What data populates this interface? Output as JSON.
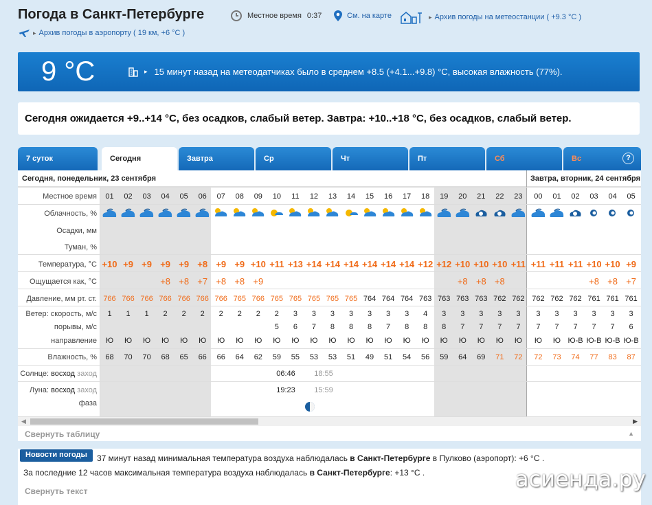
{
  "header": {
    "title": "Погода в Санкт-Петербурге",
    "local_time_label": "Местное время",
    "local_time_value": "0:37",
    "map_link": "См. на карте",
    "station_archive": "Архив погоды на метеостанции ( +9.3 °C )",
    "airport_archive": "Архив погоды в аэропорту ( 19 км, +6 °C )"
  },
  "current": {
    "temp": "9 °C",
    "desc": "15 минут назад на метеодатчиках было в среднем +8.5 (+4.1...+9.8) °C, высокая влажность (77%)."
  },
  "forecast_summary": "Сегодня ожидается +9..+14 °C, без осадков, слабый ветер. Завтра: +10..+18 °C, без осадков, слабый ветер.",
  "tabs": [
    "7 суток",
    "Сегодня",
    "Завтра",
    "Ср",
    "Чт",
    "Пт",
    "Сб",
    "Вс"
  ],
  "help_label": "?",
  "table": {
    "today_header": "Сегодня, понедельник, 23 сентября",
    "tomorrow_header": "Завтра, вторник, 24 сентября",
    "labels": {
      "time": "Местное время",
      "clouds": "Облачность, %",
      "precip": "Осадки, мм",
      "fog": "Туман, %",
      "temp": "Температура, °C",
      "feels": "Ощущается как, °C",
      "pressure": "Давление, мм рт. ст.",
      "wind_speed": "Ветер: скорость, м/с",
      "gusts": "порывы, м/с",
      "direction": "направление",
      "humidity": "Влажность, %",
      "sun_prefix": "Солнце:",
      "sun_rise": "восход",
      "sun_set": "заход",
      "moon_prefix": "Луна:",
      "moon_rise": "восход",
      "moon_set": "заход",
      "phase": "фаза"
    },
    "hours": [
      "01",
      "02",
      "03",
      "04",
      "05",
      "06",
      "07",
      "08",
      "09",
      "10",
      "11",
      "12",
      "13",
      "14",
      "15",
      "16",
      "17",
      "18",
      "19",
      "20",
      "21",
      "22",
      "23",
      "00",
      "01",
      "02",
      "03",
      "04",
      "05"
    ],
    "temp": [
      "+10",
      "+9",
      "+9",
      "+9",
      "+9",
      "+8",
      "+9",
      "+9",
      "+10",
      "+11",
      "+13",
      "+14",
      "+14",
      "+14",
      "+14",
      "+14",
      "+14",
      "+12",
      "+12",
      "+10",
      "+10",
      "+10",
      "+11",
      "+11",
      "+11",
      "+11",
      "+10",
      "+10",
      "+9"
    ],
    "feels": [
      "",
      "",
      "",
      "+8",
      "+8",
      "+7",
      "+8",
      "+8",
      "+9",
      "",
      "",
      "",
      "",
      "",
      "",
      "",
      "",
      "",
      "",
      "+8",
      "+8",
      "+8",
      "",
      "",
      "",
      "",
      "+8",
      "+8",
      "+7"
    ],
    "pressure": [
      "766",
      "766",
      "766",
      "766",
      "766",
      "766",
      "766",
      "765",
      "766",
      "765",
      "765",
      "765",
      "765",
      "765",
      "764",
      "764",
      "764",
      "763",
      "763",
      "763",
      "763",
      "762",
      "762",
      "762",
      "762",
      "762",
      "761",
      "761",
      "761"
    ],
    "pressure_warm_until": 14,
    "wind": [
      "1",
      "1",
      "1",
      "2",
      "2",
      "2",
      "2",
      "2",
      "2",
      "2",
      "3",
      "3",
      "3",
      "3",
      "3",
      "3",
      "3",
      "4",
      "3",
      "3",
      "3",
      "3",
      "3",
      "3",
      "3",
      "3",
      "3",
      "3",
      "3"
    ],
    "gusts": [
      "",
      "",
      "",
      "",
      "",
      "",
      "",
      "",
      "",
      "5",
      "6",
      "7",
      "8",
      "8",
      "8",
      "7",
      "8",
      "8",
      "8",
      "7",
      "7",
      "7",
      "7",
      "7",
      "7",
      "7",
      "7",
      "7",
      "6"
    ],
    "direction": [
      "Ю",
      "Ю",
      "Ю",
      "Ю",
      "Ю",
      "Ю",
      "Ю",
      "Ю",
      "Ю",
      "Ю",
      "Ю",
      "Ю",
      "Ю",
      "Ю",
      "Ю",
      "Ю",
      "Ю",
      "Ю",
      "Ю",
      "Ю",
      "Ю",
      "Ю",
      "Ю",
      "Ю",
      "Ю",
      "Ю-В",
      "Ю-В",
      "Ю-В",
      "Ю-В"
    ],
    "humidity": [
      "68",
      "70",
      "70",
      "68",
      "65",
      "66",
      "66",
      "64",
      "62",
      "59",
      "55",
      "53",
      "53",
      "51",
      "49",
      "51",
      "54",
      "56",
      "59",
      "64",
      "69",
      "71",
      "72",
      "72",
      "73",
      "74",
      "77",
      "83",
      "87"
    ],
    "humidity_warm_from": 21,
    "sunrise": "06:46",
    "sunset": "18:55",
    "moonrise": "19:23",
    "moonset": "15:59"
  },
  "scroll_left": "◀",
  "scroll_right": "▶",
  "collapse_table": "Свернуть таблицу",
  "collapse_arrow": "▲",
  "news": {
    "badge": "Новости погоды",
    "line1_a": "37 минут назад минимальная температура воздуха наблюдалась",
    "line1_b": "в Санкт-Петербурге",
    "line1_c": "в Пулково (аэропорт): +6 °C .",
    "line2_a": "За последние 12 часов максимальная температура воздуха наблюдалась",
    "line2_b": "в Санкт-Петербурге",
    "line2_c": ": +13 °C .",
    "collapse": "Свернуть текст"
  },
  "watermark": "асиенда.ру",
  "colors": {
    "accent": "#1469b8",
    "warm": "#f06a17",
    "night": "#e2e2e2"
  }
}
